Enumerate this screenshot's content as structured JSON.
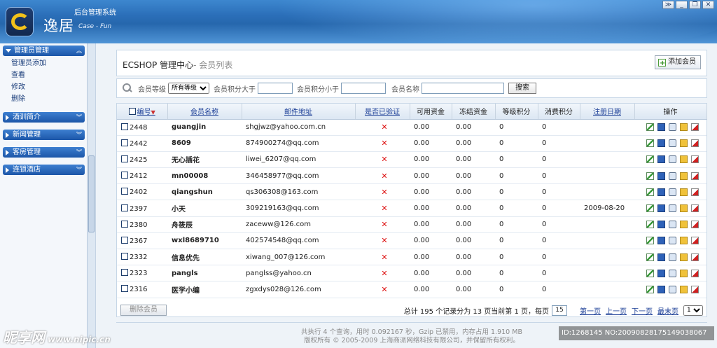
{
  "header": {
    "system_title": "后台管理系统",
    "logo_cn": "逸居",
    "logo_en": "Case",
    "logo_en_suffix": "Fun"
  },
  "window_buttons": [
    "≫",
    "_",
    "❐",
    "✕"
  ],
  "sidebar": {
    "groups": [
      {
        "label": "管理员管理",
        "expanded": true,
        "items": [
          "管理员添加",
          "查看",
          "修改",
          "删除"
        ]
      },
      {
        "label": "酒训简介",
        "expanded": false
      },
      {
        "label": "新闻管理",
        "expanded": false
      },
      {
        "label": "客房管理",
        "expanded": false
      },
      {
        "label": "连锁酒店",
        "expanded": false
      }
    ]
  },
  "page": {
    "title": "ECSHOP 管理中心",
    "subtitle": "- 会员列表",
    "add_button": "添加会员"
  },
  "search": {
    "rank_label": "会员等级",
    "rank_selected": "所有等级",
    "points_gt_label": "会员积分大于",
    "points_lt_label": "会员积分小于",
    "name_label": "会员名称",
    "button": "搜索"
  },
  "table": {
    "columns": [
      "编号",
      "会员名称",
      "邮件地址",
      "是否已验证",
      "可用资金",
      "冻结资金",
      "等级积分",
      "消费积分",
      "注册日期",
      "操作"
    ],
    "rows": [
      {
        "id": "2448",
        "name": "guangjin",
        "email": "shgjwz@yahoo.com.cn",
        "verified": "✕",
        "avail": "0.00",
        "frozen": "0.00",
        "rank_pts": "0",
        "pay_pts": "0",
        "reg": ""
      },
      {
        "id": "2442",
        "name": "8609",
        "email": "874900274@qq.com",
        "verified": "✕",
        "avail": "0.00",
        "frozen": "0.00",
        "rank_pts": "0",
        "pay_pts": "0",
        "reg": ""
      },
      {
        "id": "2425",
        "name": "无心插花",
        "email": "liwei_6207@qq.com",
        "verified": "✕",
        "avail": "0.00",
        "frozen": "0.00",
        "rank_pts": "0",
        "pay_pts": "0",
        "reg": ""
      },
      {
        "id": "2412",
        "name": "mn00008",
        "email": "346458977@qq.com",
        "verified": "✕",
        "avail": "0.00",
        "frozen": "0.00",
        "rank_pts": "0",
        "pay_pts": "0",
        "reg": ""
      },
      {
        "id": "2402",
        "name": "qiangshun",
        "email": "qs306308@163.com",
        "verified": "✕",
        "avail": "0.00",
        "frozen": "0.00",
        "rank_pts": "0",
        "pay_pts": "0",
        "reg": ""
      },
      {
        "id": "2397",
        "name": "小天",
        "email": "309219163@qq.com",
        "verified": "✕",
        "avail": "0.00",
        "frozen": "0.00",
        "rank_pts": "0",
        "pay_pts": "0",
        "reg": "2009-08-20"
      },
      {
        "id": "2380",
        "name": "舟筱辰",
        "email": "zaceww@126.com",
        "verified": "✕",
        "avail": "0.00",
        "frozen": "0.00",
        "rank_pts": "0",
        "pay_pts": "0",
        "reg": ""
      },
      {
        "id": "2367",
        "name": "wxl8689710",
        "email": "402574548@qq.com",
        "verified": "✕",
        "avail": "0.00",
        "frozen": "0.00",
        "rank_pts": "0",
        "pay_pts": "0",
        "reg": ""
      },
      {
        "id": "2332",
        "name": "信息优先",
        "email": "xiwang_007@126.com",
        "verified": "✕",
        "avail": "0.00",
        "frozen": "0.00",
        "rank_pts": "0",
        "pay_pts": "0",
        "reg": ""
      },
      {
        "id": "2323",
        "name": "pangls",
        "email": "panglss@yahoo.cn",
        "verified": "✕",
        "avail": "0.00",
        "frozen": "0.00",
        "rank_pts": "0",
        "pay_pts": "0",
        "reg": ""
      },
      {
        "id": "2316",
        "name": "医学小编",
        "email": "zgxdys028@126.com",
        "verified": "✕",
        "avail": "0.00",
        "frozen": "0.00",
        "rank_pts": "0",
        "pay_pts": "0",
        "reg": ""
      }
    ],
    "op_icons": [
      "edit-icon",
      "address-book-icon",
      "view-order-icon",
      "account-icon",
      "delete-icon"
    ]
  },
  "bottom": {
    "delete_button": "删除会员",
    "summary": "总计 195 个记录分为 13 页当前第 1 页，每页",
    "per_page": "15",
    "first": "第一页",
    "prev": "上一页",
    "next": "下一页",
    "last": "最末页",
    "page_select": "1"
  },
  "footer": {
    "line1": "共执行 4 个查询，用时 0.092167 秒，Gzip 已禁用，内存占用 1.910 MB",
    "line2": "版权所有 © 2005-2009 上海商派网络科技有限公司，并保留所有权利。"
  },
  "watermark": {
    "left": "昵享网",
    "left_url": "www.nipic.cn",
    "right": "ID:1268145 NO:20090828175149038067"
  },
  "colors": {
    "header_blue": "#2b6fb9",
    "sidebar_head": "#1c56a8",
    "link": "#1a3d96",
    "verify_x": "#d11111"
  }
}
